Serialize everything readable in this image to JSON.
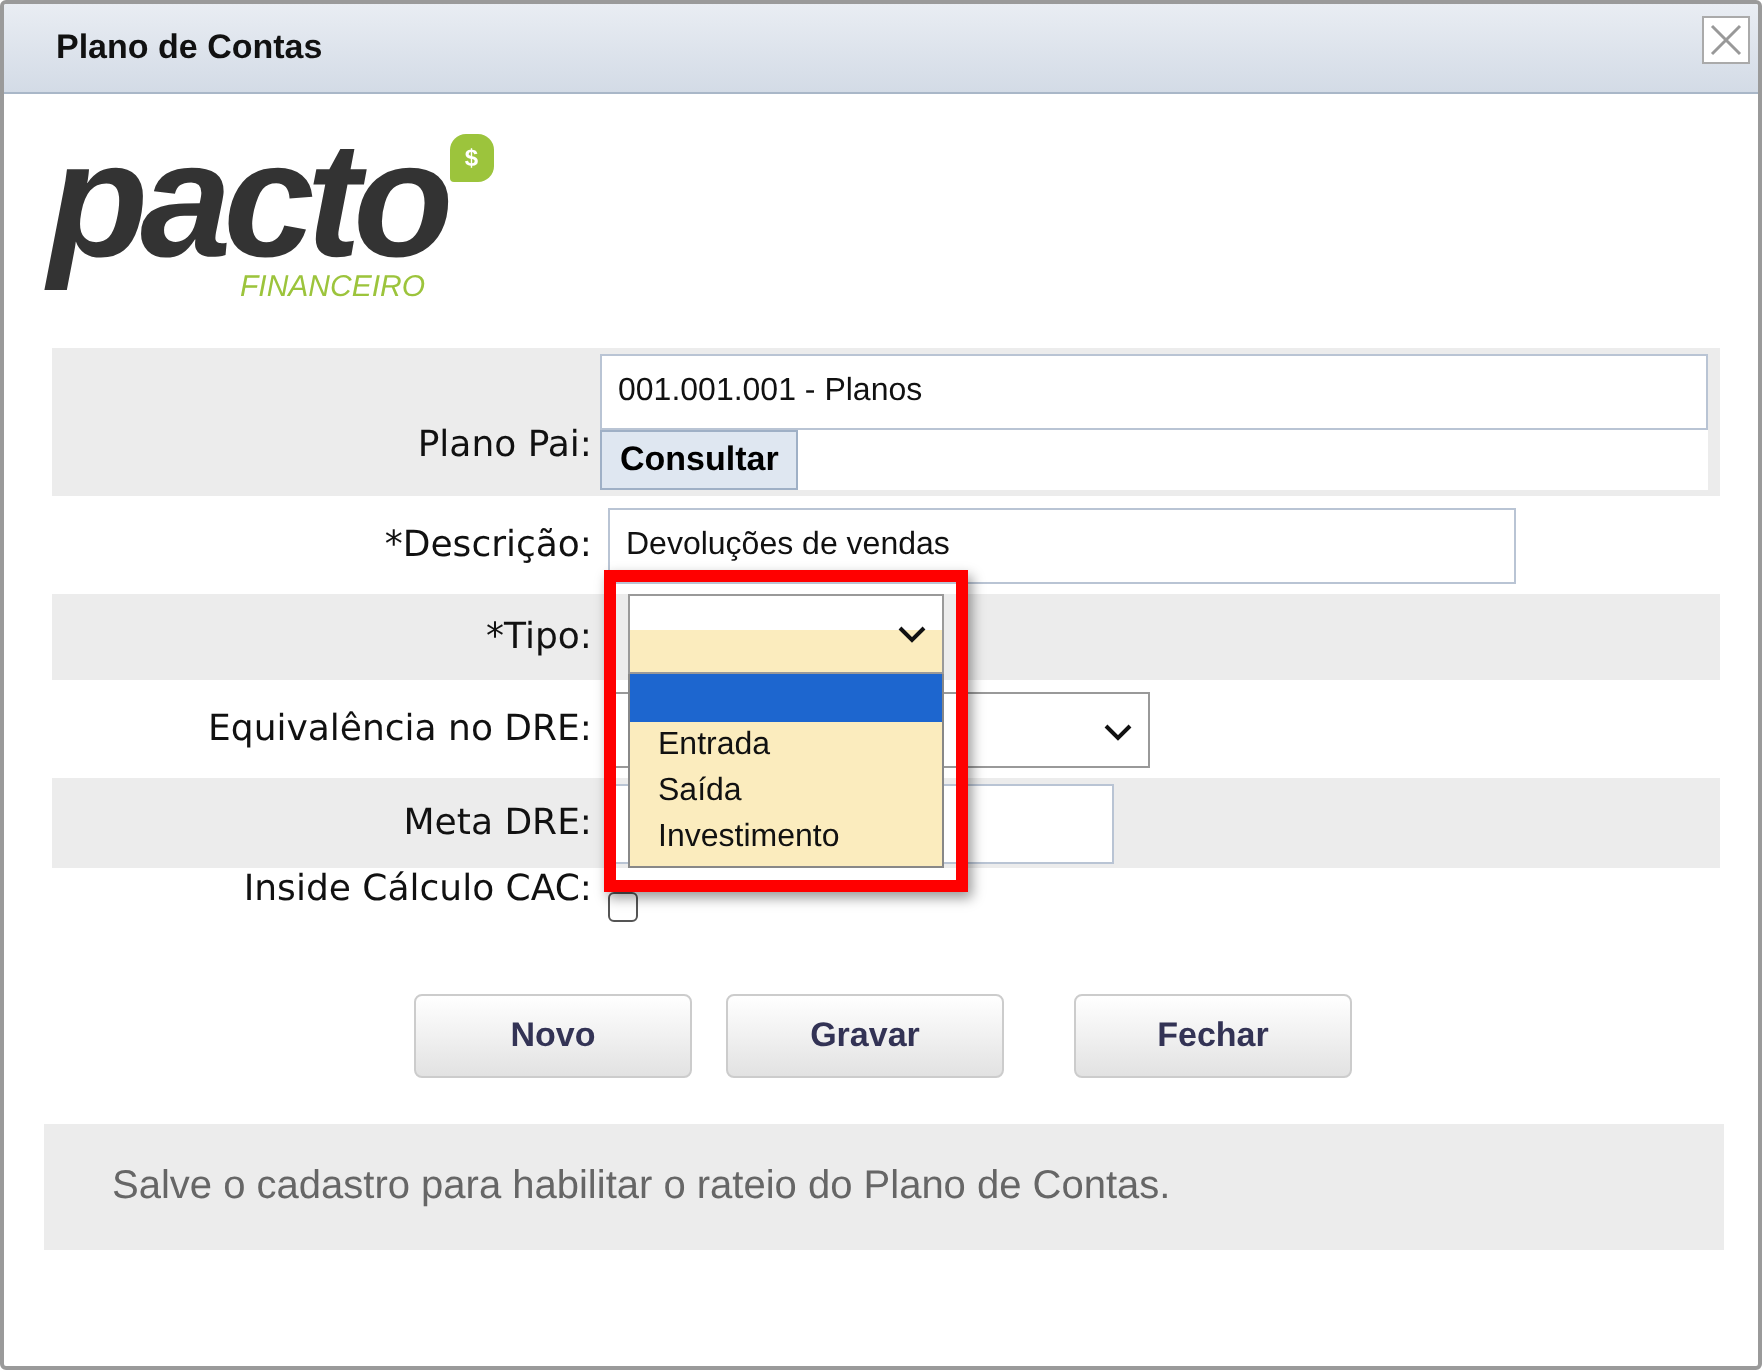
{
  "window": {
    "title": "Plano de Contas"
  },
  "logo": {
    "word": "pacto",
    "badge": "$",
    "subtitle": "FINANCEIRO"
  },
  "form": {
    "plano_pai": {
      "label": "Plano Pai:",
      "value": "001.001.001 - Planos",
      "button": "Consultar"
    },
    "descricao": {
      "label": "*Descrição:",
      "value": "Devoluções de vendas"
    },
    "tipo": {
      "label": "*Tipo:",
      "expanded": true,
      "blank_option_highlighted": true,
      "highlighted": true,
      "options": [
        {
          "label": "Entrada"
        },
        {
          "label": "Saída"
        },
        {
          "label": "Investimento"
        }
      ]
    },
    "equivalencia": {
      "label": "Equivalência no DRE:"
    },
    "meta": {
      "label": "Meta DRE:"
    },
    "cac": {
      "label": "Inside Cálculo CAC:",
      "checked": false
    }
  },
  "buttons": [
    "Novo",
    "Gravar",
    "Fechar"
  ],
  "notice": "Salve o cadastro para habilitar o rateio do Plano de Contas."
}
